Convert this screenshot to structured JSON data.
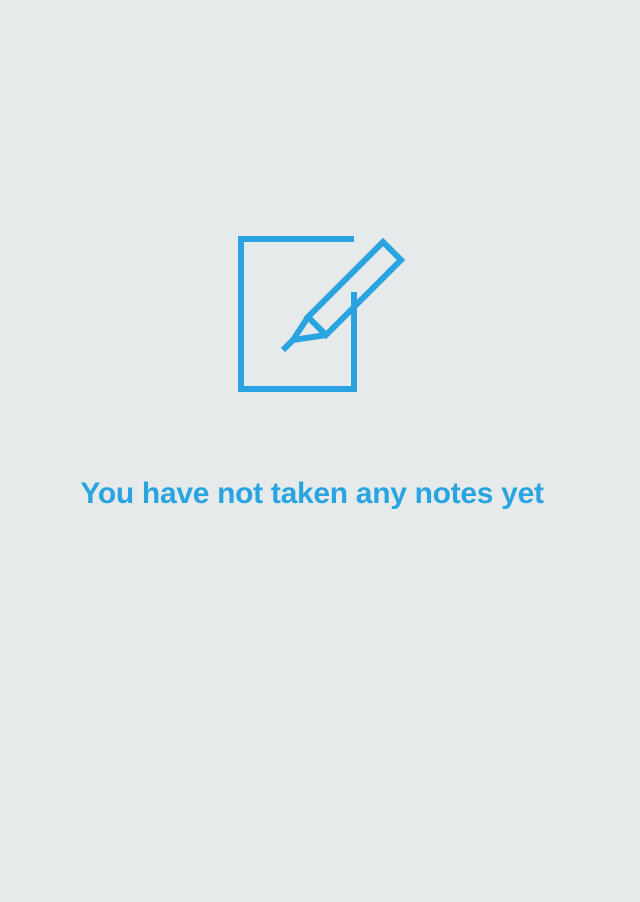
{
  "colors": {
    "background": "#e6eaeb",
    "accent": "#2aa4e0"
  },
  "empty_state": {
    "icon": "note-pencil-icon",
    "message": "You have not taken any notes yet"
  }
}
